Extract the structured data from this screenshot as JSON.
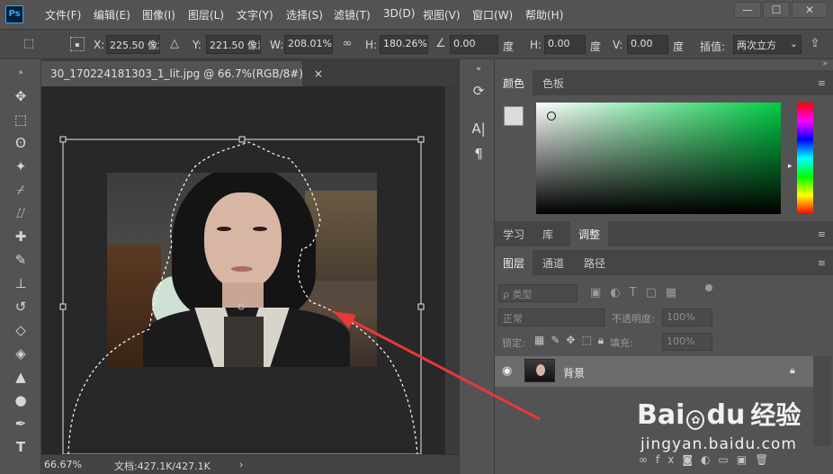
{
  "app": {
    "logo": "Ps"
  },
  "menu": [
    "文件(F)",
    "编辑(E)",
    "图像(I)",
    "图层(L)",
    "文字(Y)",
    "选择(S)",
    "滤镜(T)",
    "3D(D)",
    "视图(V)",
    "窗口(W)",
    "帮助(H)"
  ],
  "window_controls": {
    "minimize": "—",
    "maximize": "☐",
    "close": "✕"
  },
  "options": {
    "x_label": "X:",
    "x_value": "225.50 像素",
    "y_label": "Y:",
    "y_value": "221.50 像素",
    "w_label": "W:",
    "w_value": "208.01%",
    "h_label": "H:",
    "h_value": "180.26%",
    "angle_value": "0.00",
    "angle_unit": "度",
    "hskew_label": "H:",
    "hskew_value": "0.00",
    "hskew_unit": "度",
    "vskew_label": "V:",
    "vskew_value": "0.00",
    "vskew_unit": "度",
    "interp_label": "插值:",
    "interp_value": "两次立方"
  },
  "document": {
    "tab_title": "30_170224181303_1_lit.jpg @ 66.7%(RGB/8#)",
    "close": "×",
    "zoom": "66.67%",
    "doc_info": "文档:427.1K/427.1K",
    "status_arrow": "›"
  },
  "color_panel": {
    "tabs": [
      "颜色",
      "色板"
    ],
    "active": 0
  },
  "adjust_panel": {
    "tabs": [
      "学习",
      "库",
      "调整"
    ],
    "active": 2
  },
  "layers_panel": {
    "tabs": [
      "图层",
      "通道",
      "路径"
    ],
    "active": 0,
    "filter_label": "ρ 类型",
    "blend_mode": "正常",
    "opacity_label": "不透明度:",
    "opacity_value": "100%",
    "lock_label": "锁定:",
    "fill_label": "填充:",
    "fill_value": "100%",
    "layers": [
      {
        "name": "背景",
        "visible": true,
        "locked": true
      }
    ]
  },
  "watermark": {
    "brand": "Bai",
    "brand2": "du",
    "brand_cn": "经验",
    "url": "jingyan.baidu.com"
  },
  "colors": {
    "accent_blue": "#31a8ff",
    "arrow_red": "#e8383a"
  }
}
